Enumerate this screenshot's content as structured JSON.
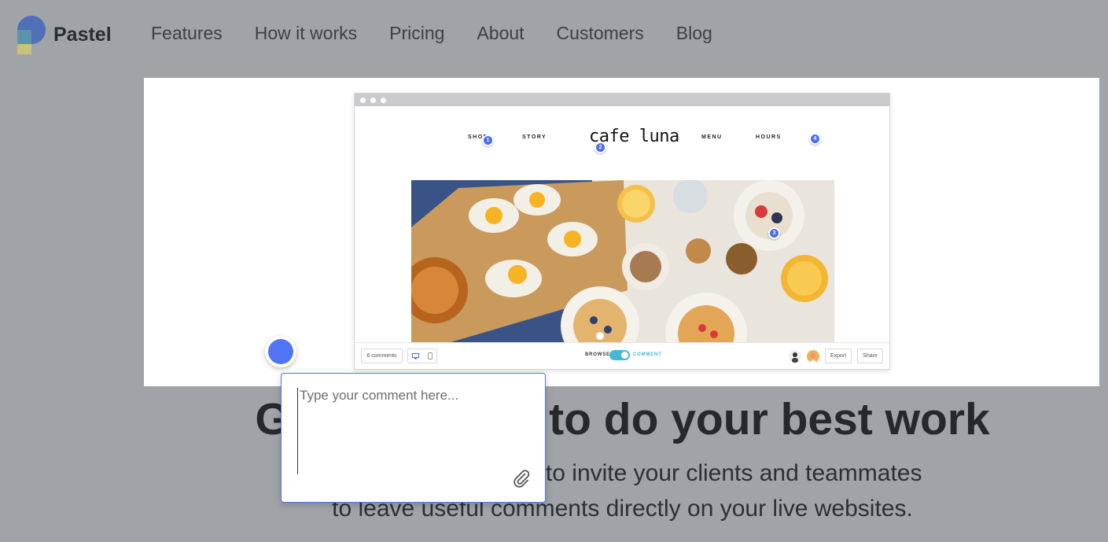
{
  "brand": {
    "name": "Pastel"
  },
  "nav": {
    "items": [
      "Features",
      "How it works",
      "Pricing",
      "About",
      "Customers",
      "Blog"
    ]
  },
  "demo": {
    "site_nav": [
      "SHOP",
      "STORY",
      "MENU",
      "HOURS"
    ],
    "site_logo": "cafe luna",
    "pins": [
      "1",
      "2",
      "3",
      "4"
    ],
    "comments_count": "6 comments",
    "mode_browse": "BROWSE",
    "mode_comment": "COMMENT",
    "export_label": "Export",
    "share_label": "Share",
    "toggle_on": true,
    "accent": "#4a6cf3",
    "toggle_color": "#44b8d6"
  },
  "hero": {
    "title": "Get feedback to do your best work",
    "subtitle_line1": "Pastel makes it easy to invite your clients and teammates",
    "subtitle_line2": "to leave useful comments directly on your live websites."
  },
  "comment": {
    "placeholder": "Type your comment here...",
    "attach_icon": "paperclip-icon"
  }
}
